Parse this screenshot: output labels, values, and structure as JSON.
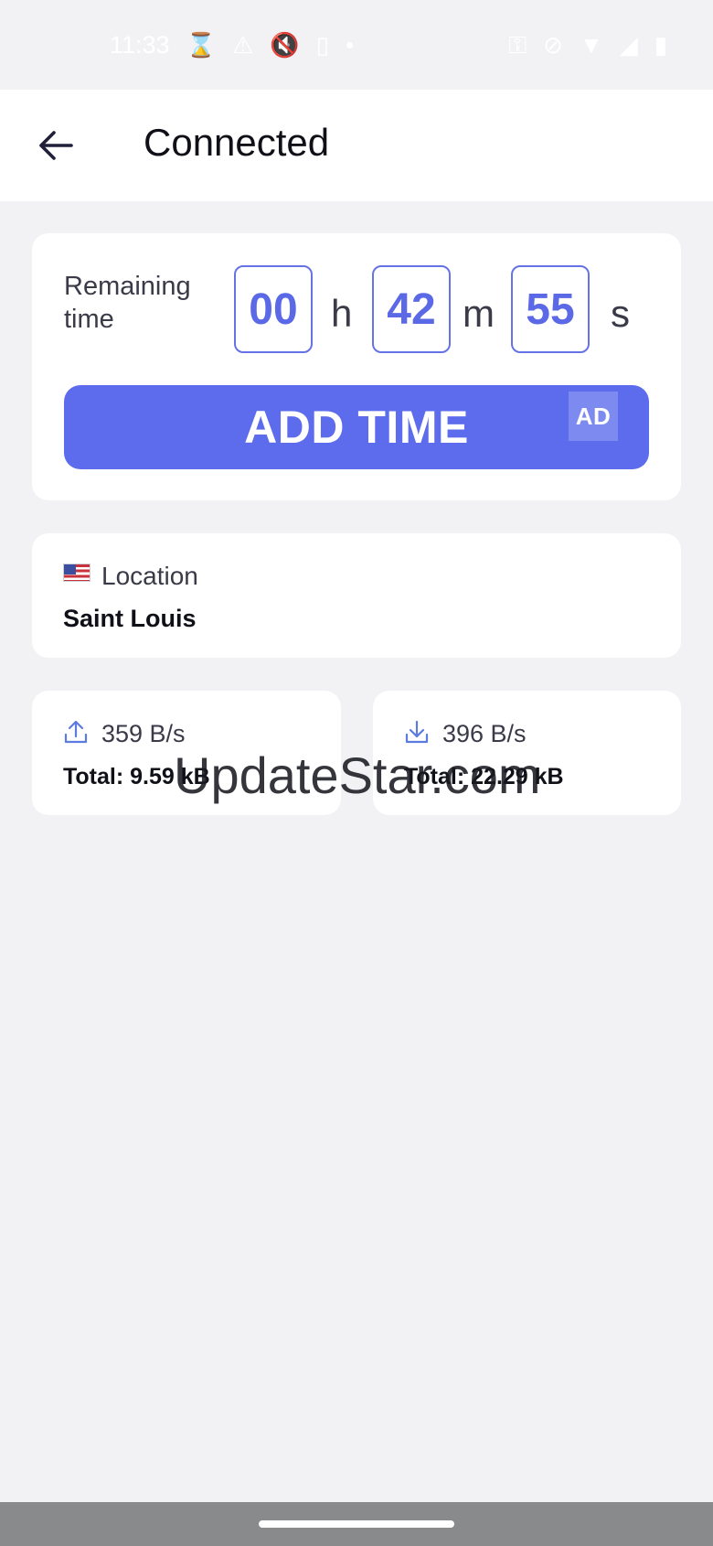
{
  "status_bar": {
    "time": "11:33"
  },
  "app_bar": {
    "title": "Connected"
  },
  "timer": {
    "label": "Remaining time",
    "hours": "00",
    "hours_unit": "h",
    "minutes": "42",
    "minutes_unit": "m",
    "seconds": "55",
    "seconds_unit": "s",
    "add_time_label": "ADD TIME",
    "ad_badge": "AD",
    "accent_color": "#5c6cec"
  },
  "location": {
    "label": "Location",
    "value": "Saint Louis",
    "flag_icon": "us-flag-icon"
  },
  "traffic": {
    "upload_speed": "359 B/s",
    "upload_total": "Total: 9.59 kB",
    "download_speed": "396 B/s",
    "download_total": "Total: 22.29 kB"
  },
  "watermark": "UpdateStar.com"
}
